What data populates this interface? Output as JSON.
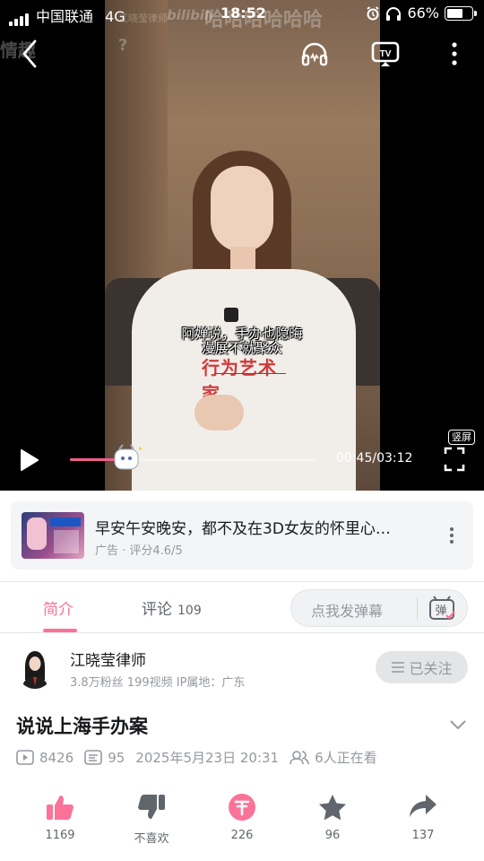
{
  "status_bar": {
    "carrier": "中国联通",
    "network": "4G",
    "time": "18:52",
    "battery": "66%",
    "battery_level": 0.66
  },
  "video": {
    "watermark_left": "情趣",
    "watermark_q": "?",
    "watermark_brand": "bilibili",
    "watermark_channel": "江晓莹律师",
    "watermark_laugh": "哈哈哈哈哈哈",
    "subtitle_line1": "阿婵说，手办也隐晦",
    "subtitle_line2": "漫展不就聚众",
    "shirt_logo": "行为艺术家",
    "current_time": "00:45",
    "duration": "03:12",
    "time_display": "00:45/03:12",
    "progress_fraction": 0.234,
    "vertical_badge": "竖屏"
  },
  "ad": {
    "title": "早安午安晚安，都不及在3D女友的怀里心…",
    "meta": "广告 · 评分4.6/5"
  },
  "tabs": {
    "intro": "简介",
    "comments": "评论",
    "comments_count": "109",
    "danmaku_placeholder": "点我发弹幕",
    "danmaku_icon_text": "弹"
  },
  "uploader": {
    "name": "江晓莹律师",
    "meta": "3.8万粉丝   199视频   IP属地：广东",
    "follow_label": "已关注"
  },
  "video_info": {
    "title": "说说上海手办案",
    "plays": "8426",
    "danmaku_count": "95",
    "date": "2025年5月23日 20:31",
    "watching": "6人正在看"
  },
  "actions": {
    "like": "1169",
    "dislike": "不喜欢",
    "coin": "226",
    "favorite": "96",
    "share": "137"
  },
  "colors": {
    "accent": "#fb7299",
    "like": "#fb7299",
    "icon_gray": "#61666d"
  }
}
